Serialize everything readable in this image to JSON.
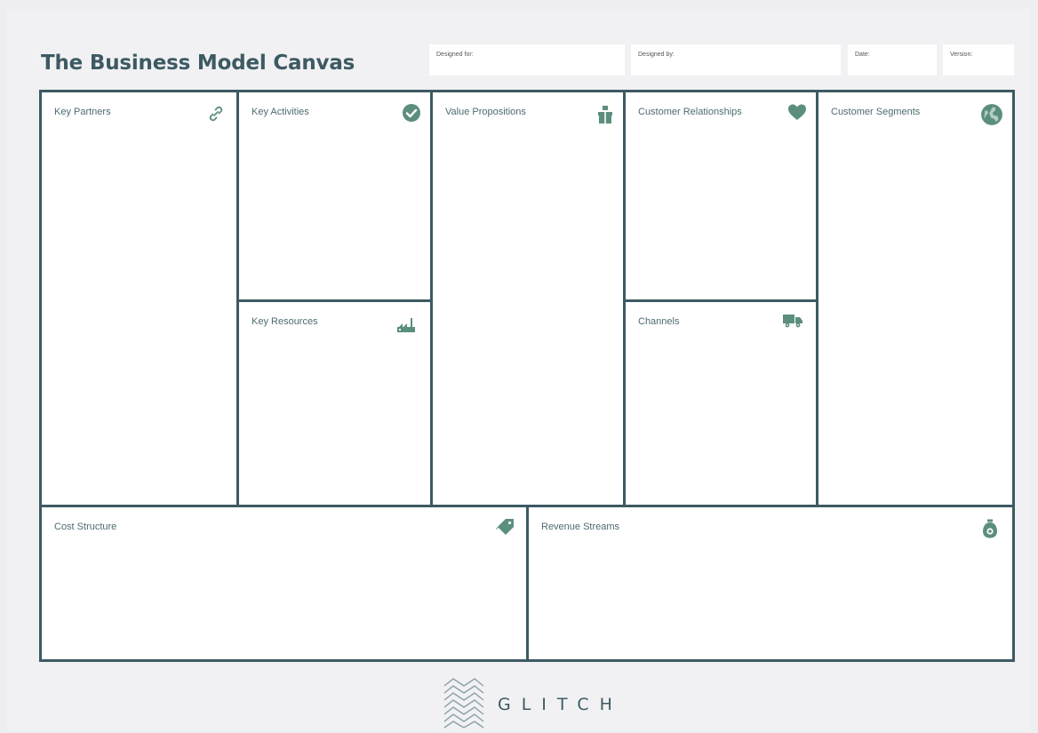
{
  "title": "The Business Model Canvas",
  "meta": {
    "designed_for": "Designed for:",
    "designed_by": "Designed by:",
    "date": "Date:",
    "version": "Version:"
  },
  "blocks": {
    "key_partners": {
      "label": "Key Partners",
      "icon": "link-icon"
    },
    "key_activities": {
      "label": "Key Activities",
      "icon": "check-circle-icon"
    },
    "key_resources": {
      "label": "Key Resources",
      "icon": "factory-icon"
    },
    "value_propositions": {
      "label": "Value Propositions",
      "icon": "gift-icon"
    },
    "customer_relationships": {
      "label": "Customer Relationships",
      "icon": "heart-icon"
    },
    "channels": {
      "label": "Channels",
      "icon": "truck-icon"
    },
    "customer_segments": {
      "label": "Customer Segments",
      "icon": "globe-icon"
    },
    "cost_structure": {
      "label": "Cost Structure",
      "icon": "tag-icon"
    },
    "revenue_streams": {
      "label": "Revenue Streams",
      "icon": "money-bag-icon"
    }
  },
  "footer": {
    "brand": "GLITCH"
  },
  "colors": {
    "primary": "#3d5a62",
    "icon": "#5c8e7e",
    "background": "#eeeef0"
  }
}
